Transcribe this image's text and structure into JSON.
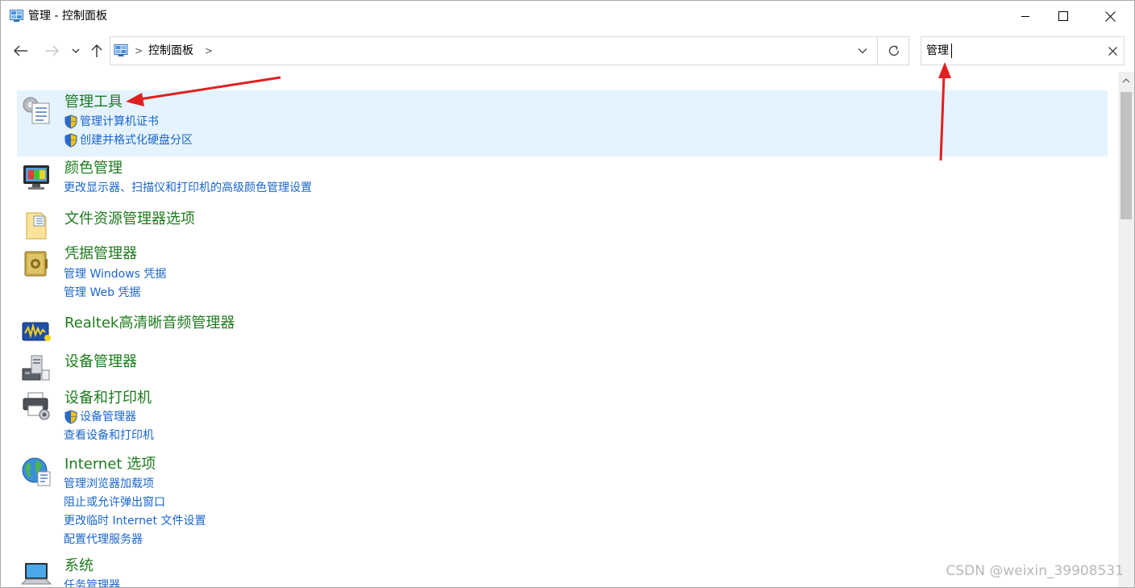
{
  "window": {
    "title": "管理 - 控制面板"
  },
  "address": {
    "crumb": "控制面板",
    "sep": ">"
  },
  "search": {
    "value": "管理"
  },
  "results": [
    {
      "title": "管理工具",
      "icon": "admin-tools-icon",
      "links": [
        {
          "text": "管理计算机证书",
          "shield": true
        },
        {
          "text": "创建并格式化硬盘分区",
          "shield": true
        }
      ]
    },
    {
      "title": "颜色管理",
      "icon": "color-management-icon",
      "links": [
        {
          "text": "更改显示器、扫描仪和打印机的高级颜色管理设置",
          "shield": false
        }
      ]
    },
    {
      "title": "文件资源管理器选项",
      "icon": "folder-options-icon",
      "links": []
    },
    {
      "title": "凭据管理器",
      "icon": "credential-vault-icon",
      "links": [
        {
          "text": "管理 Windows 凭据",
          "shield": false
        },
        {
          "text": "管理 Web 凭据",
          "shield": false
        }
      ]
    },
    {
      "title": "Realtek高清晰音频管理器",
      "icon": "realtek-audio-icon",
      "links": []
    },
    {
      "title": "设备管理器",
      "icon": "device-manager-icon",
      "links": []
    },
    {
      "title": "设备和打印机",
      "icon": "printer-icon",
      "links": [
        {
          "text": "设备管理器",
          "shield": true
        },
        {
          "text": "查看设备和打印机",
          "shield": false
        }
      ]
    },
    {
      "title": "Internet 选项",
      "icon": "globe-icon",
      "links": [
        {
          "text": "管理浏览器加载项",
          "shield": false
        },
        {
          "text": "阻止或允许弹出窗口",
          "shield": false
        },
        {
          "text": "更改临时 Internet 文件设置",
          "shield": false
        },
        {
          "text": "配置代理服务器",
          "shield": false
        }
      ]
    },
    {
      "title": "系统",
      "icon": "system-computer-icon",
      "links": [
        {
          "text": "任务管理器",
          "shield": false
        }
      ]
    }
  ],
  "watermark": "CSDN @weixin_39908531",
  "colors": {
    "title_green": "#1e7b1e",
    "link_blue": "#1a66cc",
    "selected_bg": "#e5f3ff",
    "arrow_red": "#e02020"
  }
}
